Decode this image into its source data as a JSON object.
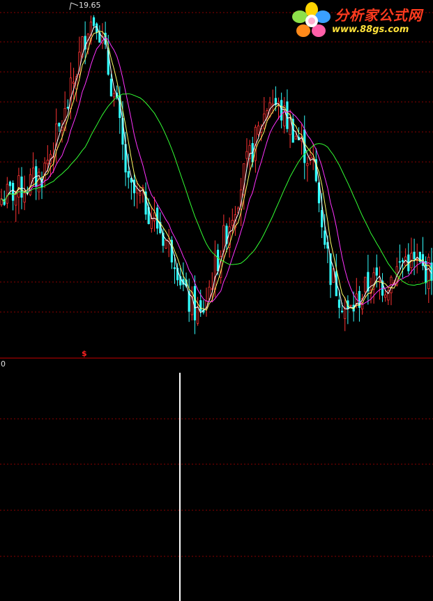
{
  "watermark": {
    "title": "分析家公式网",
    "url": "www.88gs.com"
  },
  "chart_data": [
    {
      "type": "candlestick",
      "panel": "main",
      "peak_label": "19.65",
      "series": [
        {
          "color": "#ffffff"
        },
        {
          "color": "#ffff66"
        },
        {
          "color": "#ff33ff"
        },
        {
          "color": "#33ff33"
        }
      ]
    },
    {
      "type": "bar",
      "panel": "indicator",
      "zero_label": "0",
      "signal_marker": "$",
      "spike_index": 128
    }
  ],
  "colors": {
    "up": "#ff3333",
    "down": "#33ffff",
    "grid": "#8b0000",
    "axis": "#c80000",
    "signal": "#ff2020"
  }
}
